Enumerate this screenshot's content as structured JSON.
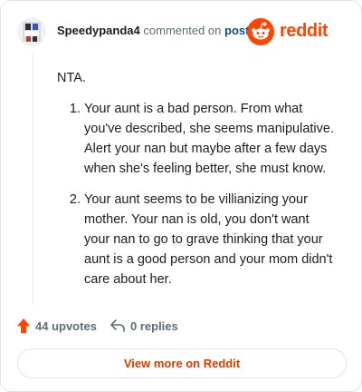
{
  "comment": {
    "username": "Speedypanda4",
    "verb": "commented on",
    "post_link": "post",
    "intro": "NTA.",
    "points": [
      "Your aunt is a bad person. From what you've described, she seems manipulative. Alert your nan but maybe after a few days when she's feeling better, she must know.",
      "Your aunt seems to be villianizing your mother. Your nan is old, you don't want your nan to go to grave thinking that your aunt is a good person and your mom didn't care about her."
    ]
  },
  "brand": {
    "name": "reddit",
    "icon": "reddit-logo-icon",
    "color": "#ff4500"
  },
  "actions": {
    "upvotes_label": "44 upvotes",
    "upvote_icon": "upvote-arrow-icon",
    "replies_label": "0 replies",
    "reply_icon": "reply-arrow-icon"
  },
  "footer": {
    "view_more_label": "View more on Reddit"
  },
  "colors": {
    "accent": "#ff4500",
    "link": "#0a4c8f",
    "muted": "#576f76",
    "button_text": "#d93a00"
  }
}
